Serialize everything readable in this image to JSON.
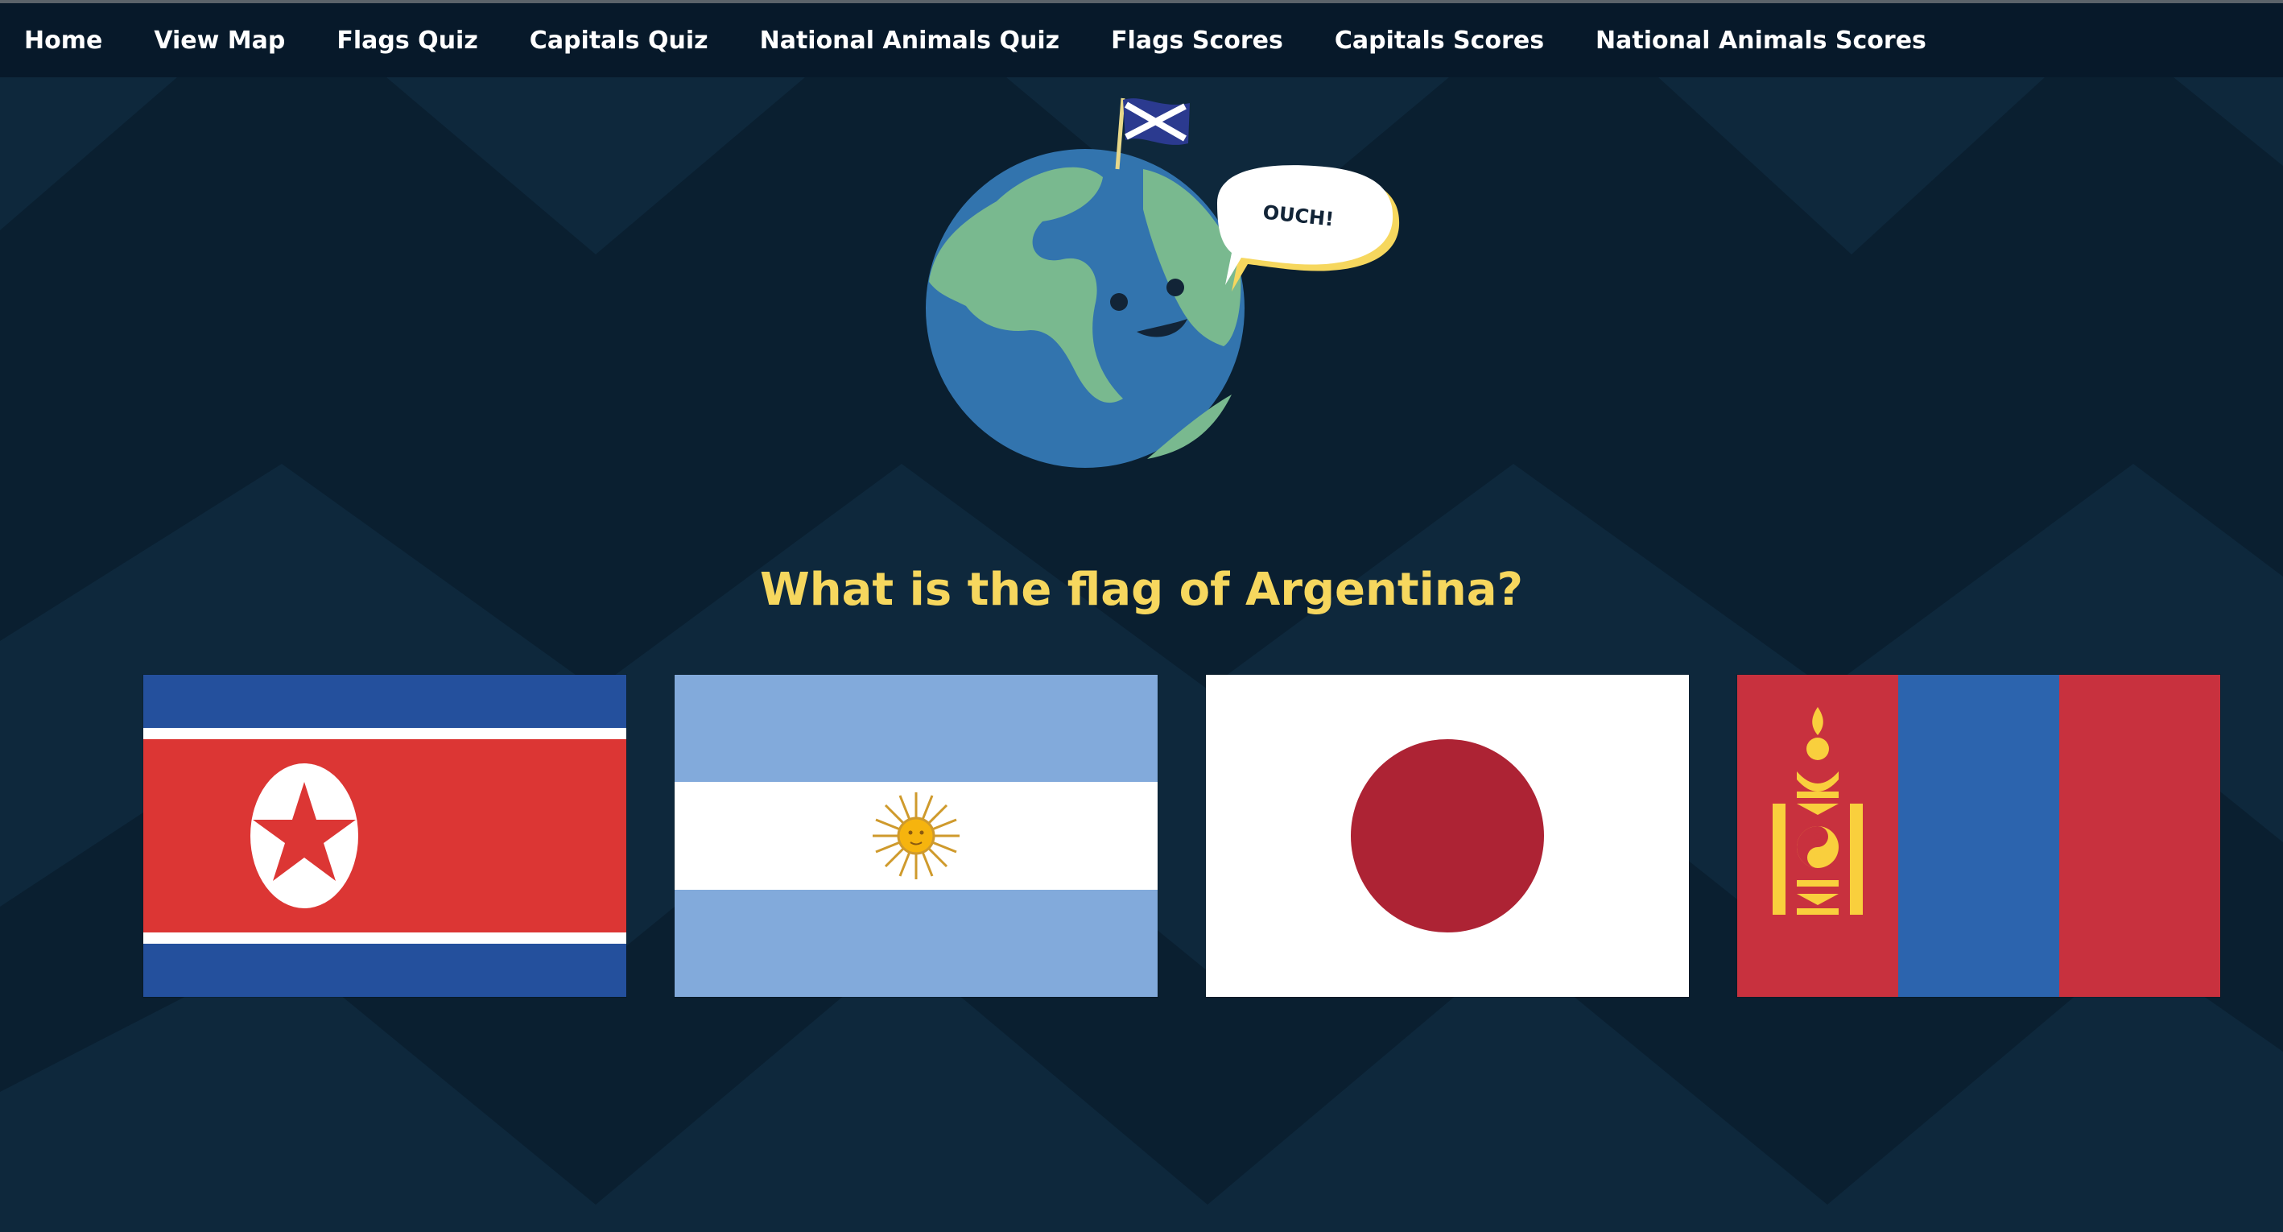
{
  "nav": {
    "items": [
      {
        "label": "Home"
      },
      {
        "label": "View Map"
      },
      {
        "label": "Flags Quiz"
      },
      {
        "label": "Capitals Quiz"
      },
      {
        "label": "National Animals Quiz"
      },
      {
        "label": "Flags Scores"
      },
      {
        "label": "Capitals Scores"
      },
      {
        "label": "National Animals Scores"
      }
    ]
  },
  "hero": {
    "speech_text": "OUCH!",
    "flag_icon": "scotland-flag-icon",
    "globe_icon": "smiling-earth-icon"
  },
  "quiz": {
    "question": "What is the flag of Argentina?",
    "options": [
      {
        "country_icon": "north-korea-flag"
      },
      {
        "country_icon": "argentina-flag"
      },
      {
        "country_icon": "japan-flag"
      },
      {
        "country_icon": "mongolia-flag"
      }
    ]
  },
  "colors": {
    "background": "#0a1f30",
    "navbar": "#07192a",
    "accent_yellow": "#f6d75e",
    "nav_text": "#ffffff"
  }
}
